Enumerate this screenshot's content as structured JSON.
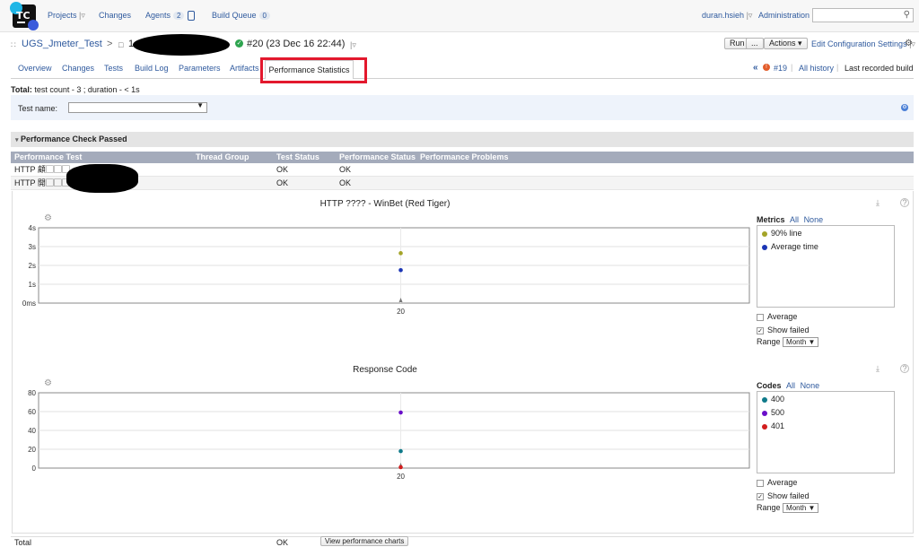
{
  "topbar": {
    "logo_text": "TC",
    "nav": {
      "projects": "Projects",
      "changes": "Changes",
      "agents": "Agents",
      "agents_count": "2",
      "build_queue": "Build Queue",
      "build_queue_count": "0"
    },
    "user": "duran.hsieh",
    "administration": "Administration",
    "search_placeholder": ""
  },
  "header": {
    "project": "UGS_Jmeter_Test",
    "build_prefix": "1",
    "build": "#20 (23 Dec 16 22:44)",
    "run": "Run",
    "run_more": "...",
    "actions": "Actions",
    "edit_config": "Edit Configuration Settings"
  },
  "tabs": [
    "Overview",
    "Changes",
    "Tests",
    "Build Log",
    "Parameters",
    "Artifacts",
    "Performance Statistics"
  ],
  "history": {
    "prev": "#19",
    "all": "All history",
    "last": "Last recorded build"
  },
  "summary": {
    "label": "Total:",
    "text": "test count - 3 ; duration - < 1s"
  },
  "filter": {
    "label": "Test name:",
    "value": ""
  },
  "section": {
    "title": "Performance Check Passed"
  },
  "table": {
    "headers": [
      "Performance Test",
      "Thread Group",
      "Test Status",
      "Performance Status",
      "Performance Problems"
    ],
    "rows": [
      {
        "name": "HTTP 顧▢▢▢ -",
        "status": "OK",
        "perf": "OK"
      },
      {
        "name": "HTTP 開▢▢▢ -",
        "status": "OK",
        "perf": "OK"
      }
    ],
    "total": {
      "label": "Total",
      "status": "OK",
      "button": "View performance charts"
    }
  },
  "colors": {
    "line90": "#a4a428",
    "avg": "#1b35b5",
    "c400": "#0f7a8a",
    "c500": "#6a0fc9",
    "c401": "#d21d1d"
  },
  "chart_data": [
    {
      "type": "scatter",
      "title": "HTTP ???? - WinBet (Red Tiger)",
      "x_ticks": [
        "20"
      ],
      "y_ticks": [
        "0ms",
        "1s",
        "2s",
        "3s",
        "4s"
      ],
      "ylim": [
        0,
        4
      ],
      "series": [
        {
          "name": "90% line",
          "x": [
            "20"
          ],
          "values": [
            2.65
          ]
        },
        {
          "name": "Average time",
          "x": [
            "20"
          ],
          "values": [
            1.75
          ]
        }
      ],
      "legend_title": "Metrics",
      "legend_all": "All",
      "legend_none": "None",
      "average_label": "Average",
      "show_failed_label": "Show failed",
      "range_label": "Range",
      "range_value": "Month"
    },
    {
      "type": "scatter",
      "title": "Response Code",
      "x_ticks": [
        "20"
      ],
      "y_ticks": [
        "0",
        "20",
        "40",
        "60",
        "80"
      ],
      "ylim": [
        0,
        80
      ],
      "series": [
        {
          "name": "400",
          "x": [
            "20"
          ],
          "values": [
            18
          ]
        },
        {
          "name": "500",
          "x": [
            "20"
          ],
          "values": [
            59
          ]
        },
        {
          "name": "401",
          "x": [
            "20"
          ],
          "values": [
            1
          ]
        }
      ],
      "legend_title": "Codes",
      "legend_all": "All",
      "legend_none": "None",
      "average_label": "Average",
      "show_failed_label": "Show failed",
      "range_label": "Range",
      "range_value": "Month"
    }
  ]
}
